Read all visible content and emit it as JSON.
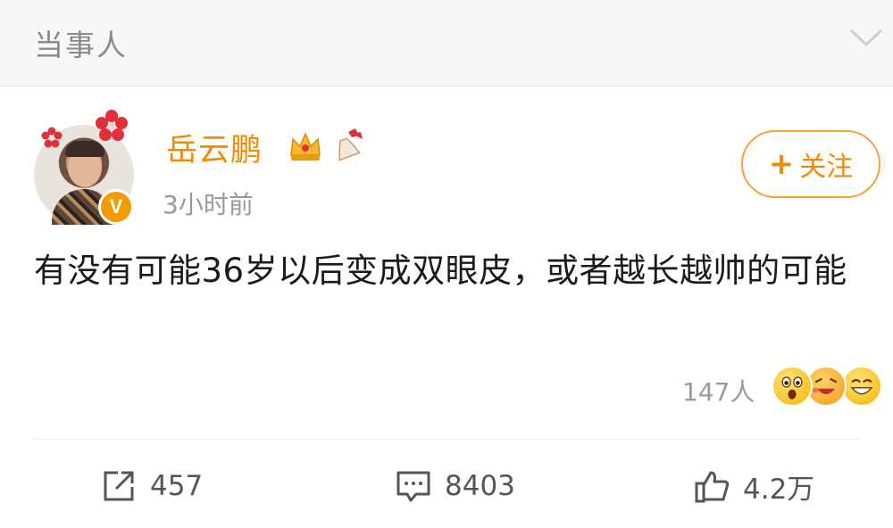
{
  "header": {
    "title": "当事人",
    "collapse_icon": "chevron-down-icon"
  },
  "post": {
    "user": {
      "name": "岳云鹏",
      "verified_badge": "V",
      "badges": [
        "crown-icon",
        "bell-icon"
      ]
    },
    "time": "3小时前",
    "follow_label": "关注",
    "text": "有没有可能36岁以后变成双眼皮，或者越长越帅的可能",
    "reactions": {
      "count": "147人",
      "emojis": [
        "surprised-emoji",
        "laughing-emoji",
        "grinning-emoji"
      ]
    }
  },
  "actions": {
    "repost": {
      "icon": "share-icon",
      "count": "457"
    },
    "comment": {
      "icon": "comment-icon",
      "count": "8403"
    },
    "like": {
      "icon": "thumbs-up-icon",
      "count": "4.2万"
    }
  },
  "colors": {
    "accent": "#f08a00",
    "muted": "#9a9a9a",
    "verified": "#f39b00"
  }
}
